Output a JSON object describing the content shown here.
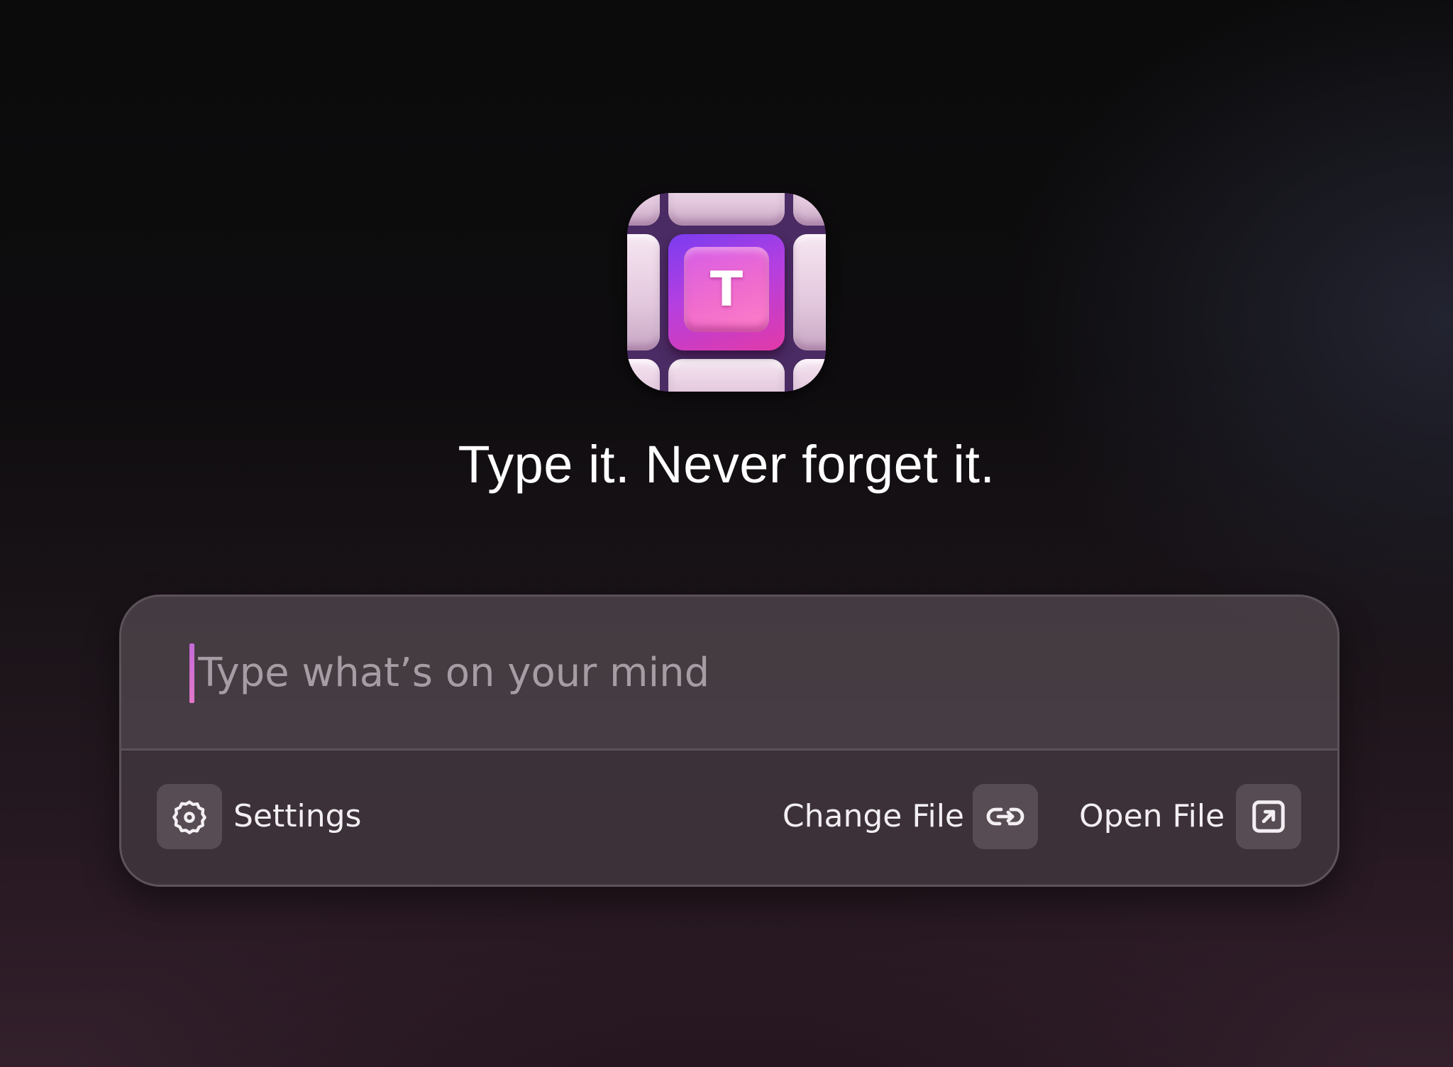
{
  "app": {
    "icon_letter": "T",
    "icon_name": "keycap-app-icon"
  },
  "tagline": "Type it. Never forget it.",
  "input": {
    "placeholder": "Type what’s on your mind",
    "value": ""
  },
  "footer": {
    "settings_label": "Settings",
    "settings_icon": "gear-icon",
    "change_file_label": "Change File",
    "change_file_icon": "link-swap-icon",
    "open_file_label": "Open File",
    "open_file_icon": "open-external-icon"
  },
  "colors": {
    "accent": "#e06fc8",
    "caret": "#c56ad8",
    "text": "#ffffff",
    "placeholder": "#a59da3"
  }
}
